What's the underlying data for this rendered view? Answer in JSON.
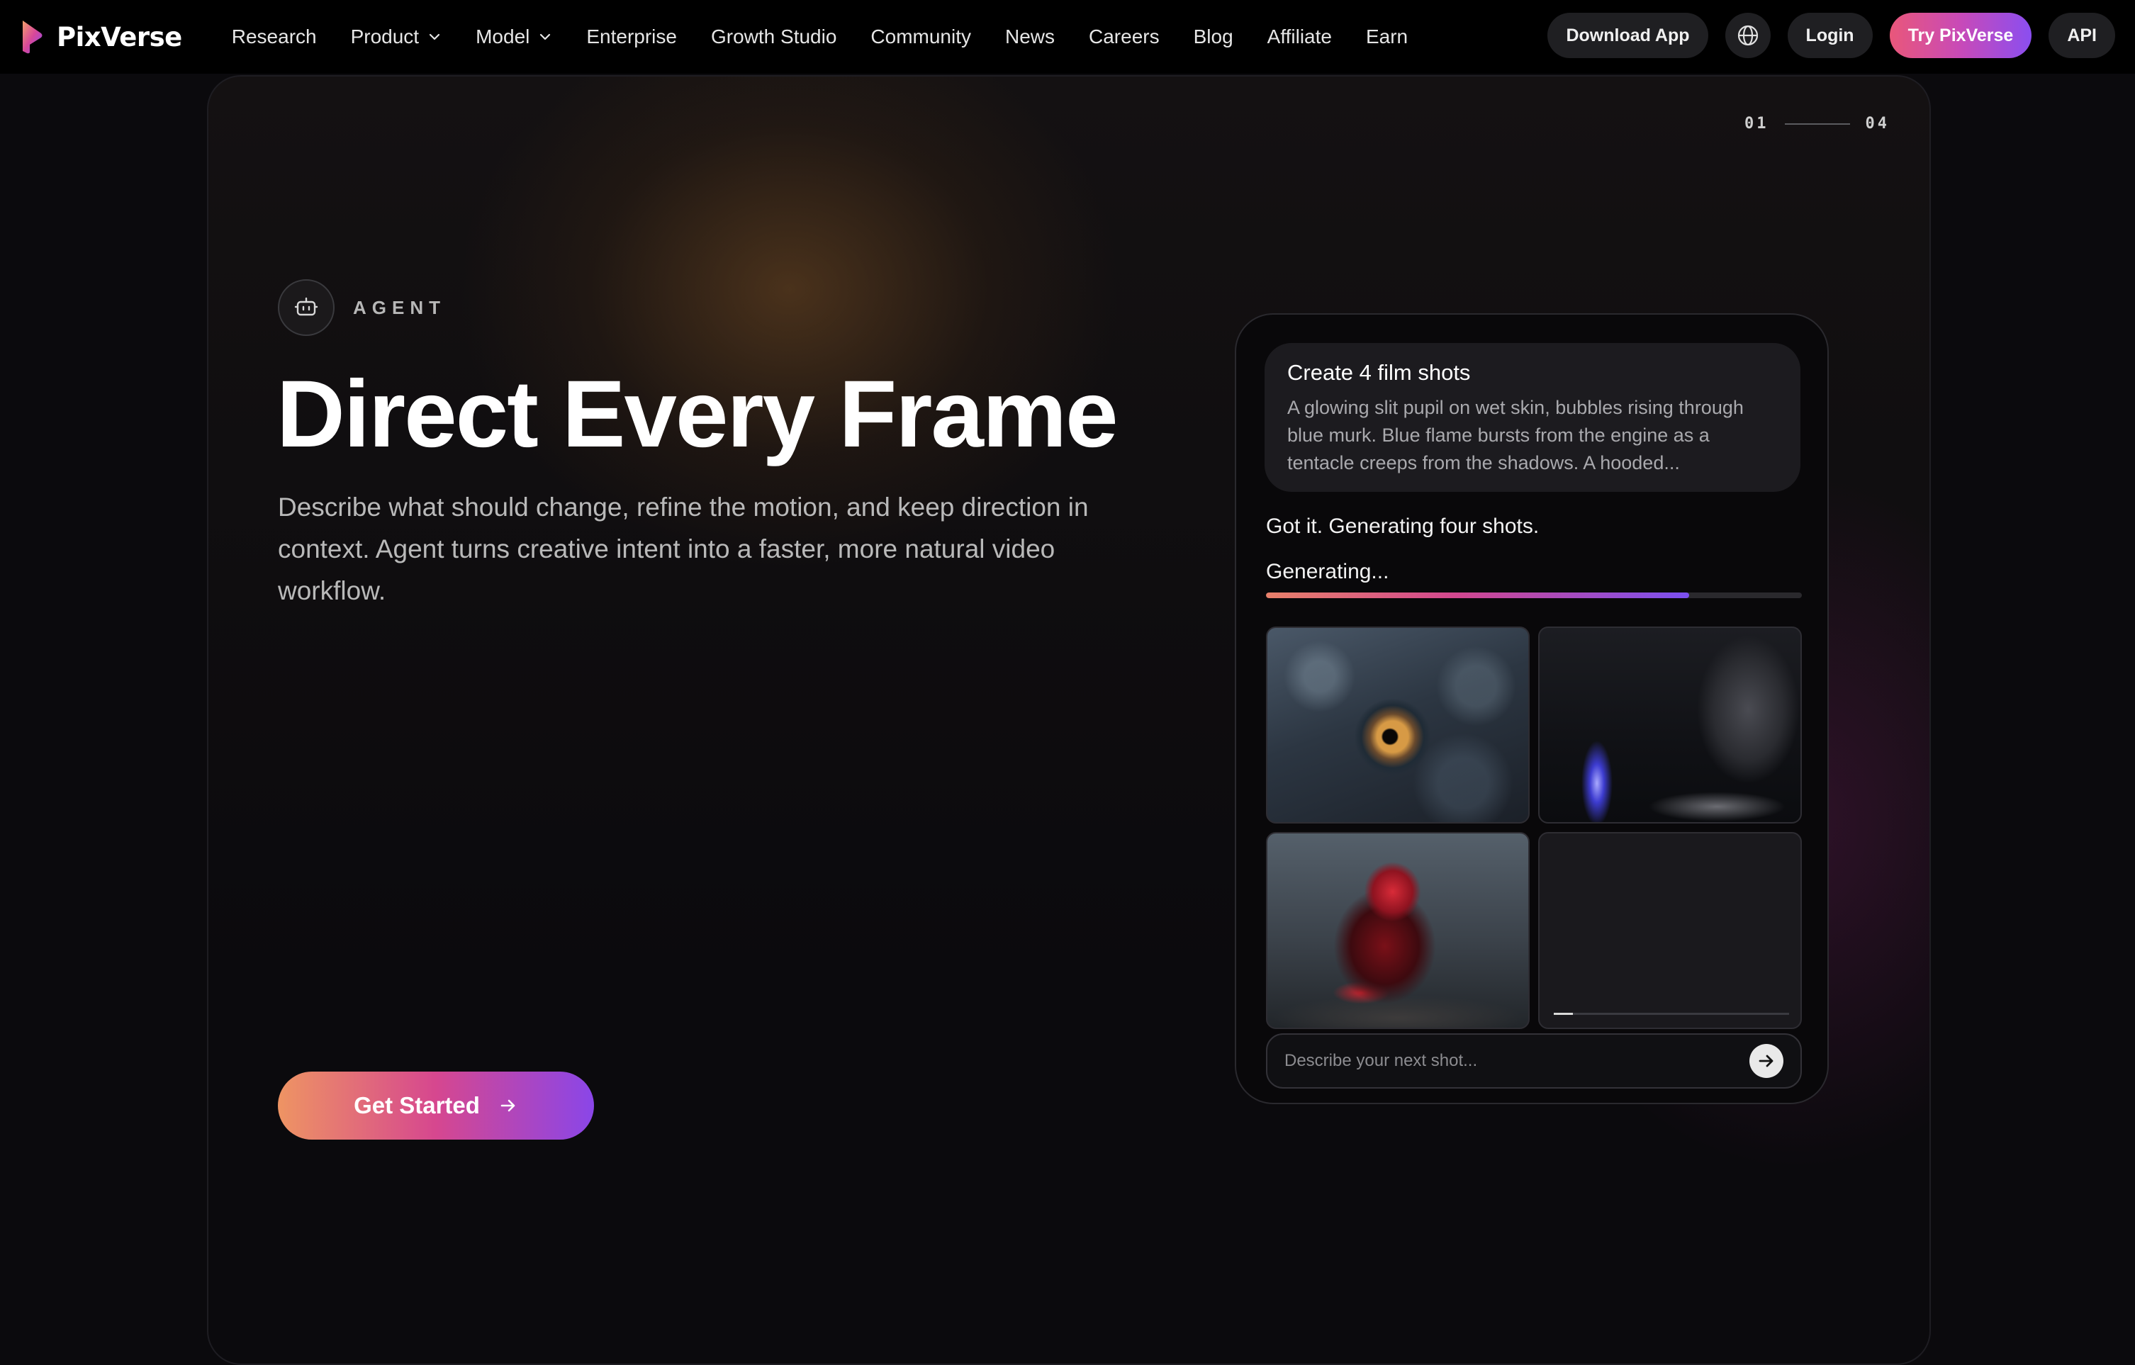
{
  "nav": {
    "brand": "PixVerse",
    "links": [
      {
        "label": "Research"
      },
      {
        "label": "Product"
      },
      {
        "label": "Model"
      },
      {
        "label": "Enterprise"
      },
      {
        "label": "Growth Studio"
      },
      {
        "label": "Community"
      },
      {
        "label": "News"
      },
      {
        "label": "Careers"
      },
      {
        "label": "Blog"
      },
      {
        "label": "Affiliate"
      },
      {
        "label": "Earn"
      }
    ],
    "download_label": "Download App",
    "login_label": "Login",
    "try_label": "Try PixVerse",
    "api_label": "API",
    "icons": {
      "language": "globe-icon",
      "dropdown": "chevron-down-icon"
    }
  },
  "hero": {
    "pager_current": "01",
    "pager_total": "04",
    "tag": "AGENT",
    "tag_icon": "robot-icon",
    "headline": "Direct Every Frame",
    "description": "Describe what should change, refine the motion, and keep direction in context. Agent turns creative intent into a faster, more natural video workflow.",
    "cta_label": "Get Started"
  },
  "agent_panel": {
    "prompt_title": "Create 4 film shots",
    "prompt_body": "A glowing slit pupil on wet skin, bubbles rising through blue murk. Blue flame bursts from the engine as a tentacle creeps from the shadows. A hooded...",
    "reply": "Got it. Generating four shots.",
    "status": "Generating...",
    "progress": 0.79,
    "shots": [
      {
        "subject": "reptile eye close-up",
        "state": "done"
      },
      {
        "subject": "blue flame engine with hooded figure",
        "state": "done"
      },
      {
        "subject": "figure in red hood",
        "state": "done"
      },
      {
        "subject": "pending shot",
        "state": "generating",
        "progress": 0.08
      }
    ],
    "input_placeholder": "Describe your next shot...",
    "send_icon": "arrow-right-icon"
  },
  "colors": {
    "accent_start": "#ee9463",
    "accent_mid": "#d6478f",
    "accent_end": "#8a46e8",
    "background": "#0b0a0d"
  }
}
